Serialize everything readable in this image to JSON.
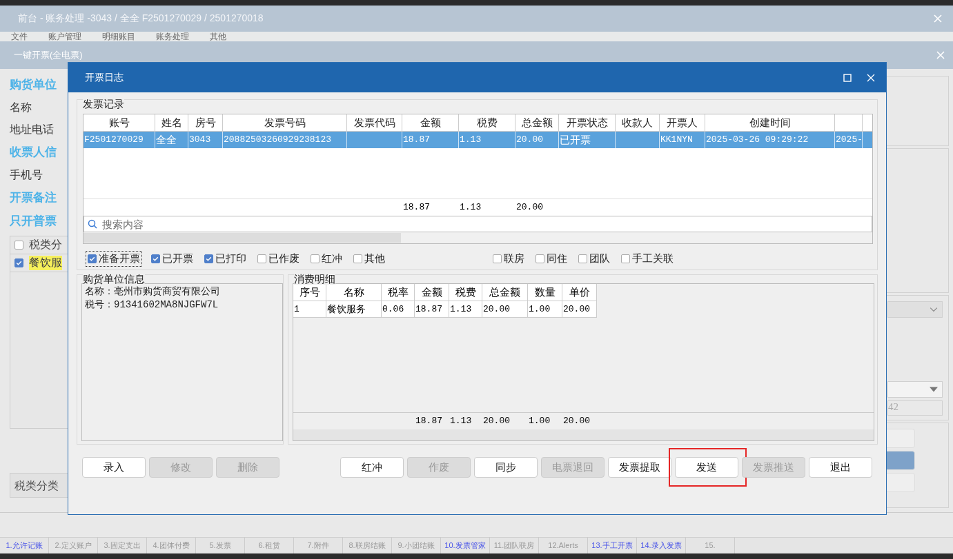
{
  "app_window": {
    "title": "前台 - 账务处理 -3043 / 全全 F2501270029 / 2501270018",
    "menu": [
      "文件",
      "账户管理",
      "明细账目",
      "账务处理",
      "其他"
    ]
  },
  "sub_window": {
    "title": "一键开票(全电票)"
  },
  "left_panel": [
    {
      "kind": "heading",
      "text": "购货单位"
    },
    {
      "kind": "label",
      "text": "名称"
    },
    {
      "kind": "label",
      "text": "地址电话"
    },
    {
      "kind": "heading",
      "text": "收票人信"
    },
    {
      "kind": "label",
      "text": "手机号"
    },
    {
      "kind": "heading",
      "text": "开票备注"
    },
    {
      "kind": "heading",
      "text": "只开普票"
    }
  ],
  "tax_table": {
    "header": {
      "checked": false,
      "text": "税类分"
    },
    "rows": [
      {
        "checked": true,
        "text": "餐饮服"
      }
    ]
  },
  "tax_field": {
    "label": "税类分类"
  },
  "right_field": {
    "value": "42"
  },
  "dialog": {
    "title": "开票日志",
    "records": {
      "title": "发票记录",
      "columns": [
        {
          "label": "账号"
        },
        {
          "label": "姓名"
        },
        {
          "label": "房号"
        },
        {
          "label": "发票号码"
        },
        {
          "label": "发票代码"
        },
        {
          "label": "金额"
        },
        {
          "label": "税费"
        },
        {
          "label": "总金额"
        },
        {
          "label": "开票状态"
        },
        {
          "label": "收款人"
        },
        {
          "label": "开票人"
        },
        {
          "label": "创建时间"
        },
        {}
      ],
      "rows": [
        {
          "selected": true,
          "cells": [
            "F2501270029",
            "全全",
            "3043",
            "20882503260929238123",
            "",
            "18.87",
            "1.13",
            "20.00",
            "已开票",
            "",
            "KK1NYN",
            "2025-03-26 09:29:22",
            "2025-"
          ]
        }
      ],
      "totals": {
        "cells": [
          "",
          "",
          "",
          "",
          "",
          "18.87",
          "1.13",
          "20.00",
          "",
          "",
          "",
          "",
          ""
        ]
      },
      "search": {
        "placeholder": "搜索内容"
      },
      "filters": [
        {
          "label": "准备开票",
          "checked": true,
          "focused": true
        },
        {
          "label": "已开票",
          "checked": true,
          "focused": false
        },
        {
          "label": "已打印",
          "checked": true,
          "focused": false
        },
        {
          "label": "已作废",
          "checked": false,
          "focused": false
        },
        {
          "label": "红冲",
          "checked": false,
          "focused": false
        },
        {
          "label": "其他",
          "checked": false,
          "focused": false
        }
      ],
      "filters_right": [
        {
          "label": "联房",
          "checked": false,
          "focused": false
        },
        {
          "label": "同住",
          "checked": false,
          "focused": false
        },
        {
          "label": "团队",
          "checked": false,
          "focused": false
        },
        {
          "label": "手工关联",
          "checked": false,
          "focused": false
        }
      ]
    },
    "buyer": {
      "title": "购货单位信息",
      "lines": [
        "名称：亳州市购货商贸有限公司",
        "税号：91341602MA8NJGFW7L"
      ]
    },
    "details": {
      "title": "消费明细",
      "columns": [
        {
          "label": "序号"
        },
        {
          "label": "名称"
        },
        {
          "label": "税率"
        },
        {
          "label": "金额"
        },
        {
          "label": "税费"
        },
        {
          "label": "总金额"
        },
        {
          "label": "数量"
        },
        {
          "label": "单价"
        }
      ],
      "rows": [
        {
          "cells": [
            "1",
            "餐饮服务",
            "0.06",
            "18.87",
            "1.13",
            "20.00",
            "1.00",
            "20.00"
          ]
        }
      ],
      "totals": {
        "cells": [
          "",
          "",
          "",
          "18.87",
          "1.13",
          "20.00",
          "1.00",
          "20.00"
        ]
      }
    },
    "buttons_left": [
      {
        "label": "录入",
        "disabled": false
      },
      {
        "label": "修改",
        "disabled": true
      },
      {
        "label": "删除",
        "disabled": true
      }
    ],
    "buttons_right": [
      {
        "label": "红冲",
        "disabled": false
      },
      {
        "label": "作废",
        "disabled": true
      },
      {
        "label": "同步",
        "disabled": false
      },
      {
        "label": "电票退回",
        "disabled": true
      },
      {
        "label": "发票提取",
        "disabled": false
      },
      {
        "label": "发送",
        "disabled": false,
        "highlighted": true
      },
      {
        "label": "发票推送",
        "disabled": true
      },
      {
        "label": "退出",
        "disabled": false
      }
    ]
  },
  "bottom_tabs": [
    {
      "label": "1.允许记账",
      "enabled": true
    },
    {
      "label": "2.定义账户",
      "enabled": false
    },
    {
      "label": "3.固定支出",
      "enabled": false
    },
    {
      "label": "4.团体付费",
      "enabled": false
    },
    {
      "label": "5.发票",
      "enabled": false
    },
    {
      "label": "6.租赁",
      "enabled": false
    },
    {
      "label": "7.附件",
      "enabled": false
    },
    {
      "label": "8.联房结账",
      "enabled": false
    },
    {
      "label": "9.小团结账",
      "enabled": false
    },
    {
      "label": "10.发票管家",
      "enabled": true
    },
    {
      "label": "11.团队联房",
      "enabled": false
    },
    {
      "label": "12.Alerts",
      "enabled": false
    },
    {
      "label": "13.手工开票",
      "enabled": true
    },
    {
      "label": "14.录入发票",
      "enabled": true
    },
    {
      "label": "15.",
      "enabled": false
    }
  ]
}
